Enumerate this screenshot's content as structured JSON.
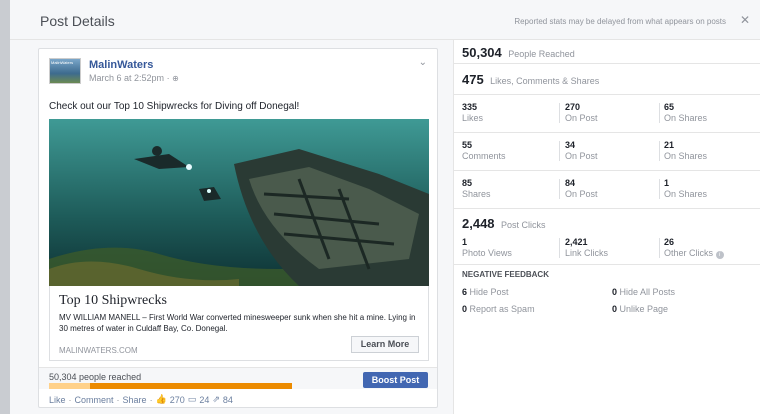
{
  "header": {
    "title": "Post Details",
    "note": "Reported stats may be delayed from what appears on posts",
    "close_icon": "close-icon"
  },
  "post": {
    "page_name": "MalinWaters",
    "avatar_text": "MalinWaters",
    "date": "March 6 at 2:52pm",
    "date_separator": "·",
    "text": "Check out our Top 10 Shipwrecks for Diving off Donegal!",
    "link": {
      "title": "Top 10 Shipwrecks",
      "description": "MV WILLIAM MANELL – First World War converted minesweeper sunk when she hit a mine. Lying in 30 metres of water in Culdaff Bay, Co. Donegal.",
      "domain": "MALINWATERS.COM",
      "button": "Learn More"
    },
    "reach_text": "50,304 people reached",
    "reach_bar": {
      "organic_fraction": 0.17,
      "paid_fraction": 0.83
    },
    "boost_label": "Boost Post",
    "actions": {
      "like": "Like",
      "comment": "Comment",
      "share": "Share",
      "separator": "·",
      "likes": "270",
      "comments": "24",
      "shares": "84"
    }
  },
  "stats": {
    "people_reached": {
      "value": "50,304",
      "label": "People Reached"
    },
    "engagement": {
      "value": "475",
      "label": "Likes, Comments & Shares"
    },
    "rows": [
      [
        {
          "value": "335",
          "label": "Likes"
        },
        {
          "value": "270",
          "label": "On Post"
        },
        {
          "value": "65",
          "label": "On Shares"
        }
      ],
      [
        {
          "value": "55",
          "label": "Comments"
        },
        {
          "value": "34",
          "label": "On Post"
        },
        {
          "value": "21",
          "label": "On Shares"
        }
      ],
      [
        {
          "value": "85",
          "label": "Shares"
        },
        {
          "value": "84",
          "label": "On Post"
        },
        {
          "value": "1",
          "label": "On Shares"
        }
      ]
    ],
    "post_clicks": {
      "value": "2,448",
      "label": "Post Clicks"
    },
    "clicks_row": [
      {
        "value": "1",
        "label": "Photo Views"
      },
      {
        "value": "2,421",
        "label": "Link Clicks"
      },
      {
        "value": "26",
        "label": "Other Clicks"
      }
    ],
    "negative_feedback": {
      "title": "NEGATIVE FEEDBACK",
      "items": [
        {
          "value": "6",
          "label": "Hide Post"
        },
        {
          "value": "0",
          "label": "Hide All Posts"
        },
        {
          "value": "0",
          "label": "Report as Spam"
        },
        {
          "value": "0",
          "label": "Unlike Page"
        }
      ]
    }
  },
  "colors": {
    "accent": "#4267b2",
    "link": "#365899",
    "reach_paid": "#ec8b00",
    "reach_organic": "#ffd18a"
  }
}
